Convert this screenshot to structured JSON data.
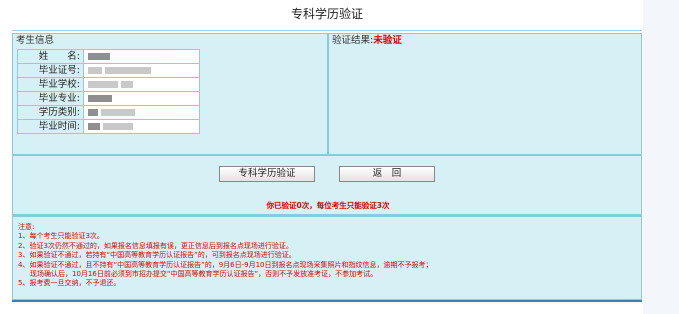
{
  "page": {
    "title": "专科学历验证"
  },
  "student_info": {
    "header": "考生信息",
    "fields": [
      {
        "label": "姓　　名:"
      },
      {
        "label": "毕业证号:"
      },
      {
        "label": "毕业学校:"
      },
      {
        "label": "毕业专业:"
      },
      {
        "label": "学历类别:"
      },
      {
        "label": "毕业时间:"
      }
    ]
  },
  "verification": {
    "label": "验证结果:",
    "status": "未验证",
    "status_color": "#e00000"
  },
  "actions": {
    "verify_button": "专科学历验证",
    "back_button": "返　回",
    "attempts_message": "你已验证0次，每位考生只能验证3次"
  },
  "notes": {
    "title": "注意:",
    "items": [
      "1、每个考生只能验证3次。",
      "2、验证3次仍然不通过的，如果报名信息填报有误，更正信息后到报名点现场进行验证。",
      "3、如果验证不通过，若持有“中国高等教育学历认证报告”的，可到报名点现场进行验证。",
      "4、如果验证不通过，且不持有“中国高等教育学历认证报告”的，9月6日-9月10日到报名点现场采集照片和指纹信息，逾期不予报考；",
      "现场确认后，10月16日前必须到市招办提交“中国高等教育学历认证报告”，否则不予发放准考证，不参加考试。",
      "5、报考费一旦交纳，不予退还。"
    ]
  },
  "colors": {
    "panel_bg": "#d6f1f6",
    "panel_border": "#8cc9d9",
    "accent_line": "#3a7fbf",
    "alert_red": "#e00000"
  }
}
